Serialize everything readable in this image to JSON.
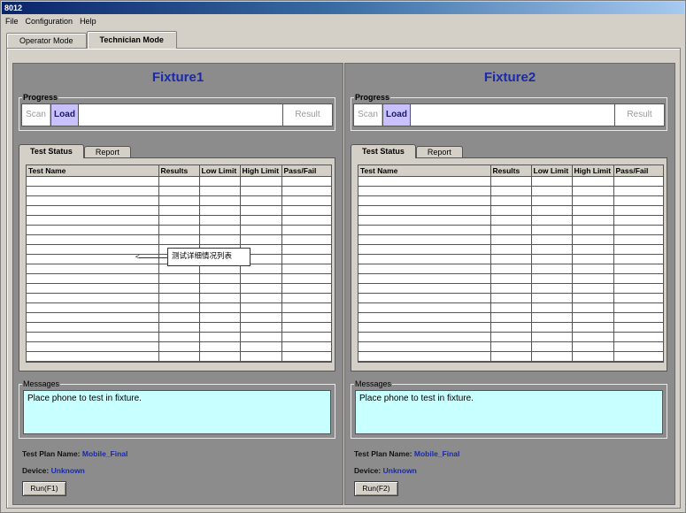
{
  "window": {
    "title": "8012"
  },
  "menu": {
    "file": "File",
    "configuration": "Configuration",
    "help": "Help"
  },
  "mode_tabs": [
    {
      "label": "Operator Mode",
      "active": false
    },
    {
      "label": "Technician Mode",
      "active": true
    }
  ],
  "fixtures": [
    {
      "title": "Fixture1",
      "progress_label": "Progress",
      "progress": {
        "scan": "Scan",
        "load": "Load",
        "result": "Result"
      },
      "tabs": {
        "status": "Test Status",
        "report": "Report"
      },
      "columns": [
        "Test Name",
        "Results",
        "Low Limit",
        "High Limit",
        "Pass/Fail"
      ],
      "messages_label": "Messages",
      "message": "Place phone to test in fixture.",
      "plan_label": "Test Plan Name:",
      "plan_value": "Mobile_Final",
      "device_label": "Device:",
      "device_value": "Unknown",
      "run_button": "Run(F1)"
    },
    {
      "title": "Fixture2",
      "progress_label": "Progress",
      "progress": {
        "scan": "Scan",
        "load": "Load",
        "result": "Result"
      },
      "tabs": {
        "status": "Test Status",
        "report": "Report"
      },
      "columns": [
        "Test Name",
        "Results",
        "Low Limit",
        "High Limit",
        "Pass/Fail"
      ],
      "messages_label": "Messages",
      "message": "Place phone to test in fixture.",
      "plan_label": "Test Plan Name:",
      "plan_value": "Mobile_Final",
      "device_label": "Device:",
      "device_value": "Unknown",
      "run_button": "Run(F2)"
    }
  ],
  "annotation": {
    "callout": "测试详细情况列表"
  },
  "colors": {
    "fixture_title": "#1a2aa8",
    "load_highlight": "#c8c0ff",
    "message_bg": "#c8ffff",
    "panel_bg": "#8c8c8c"
  }
}
